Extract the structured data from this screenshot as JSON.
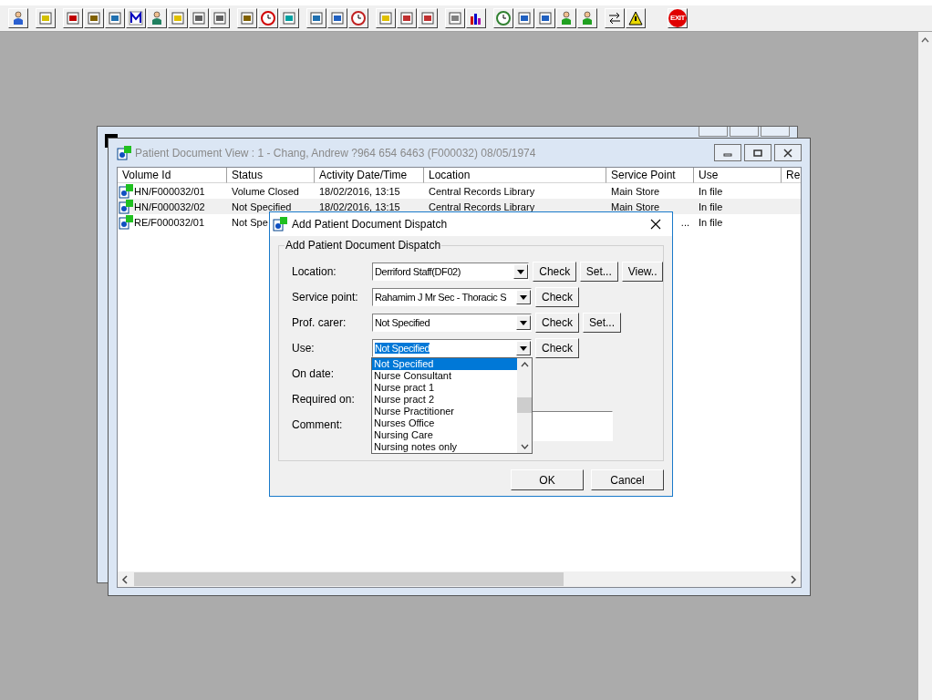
{
  "toolbar": {
    "exit_label": "EXIT"
  },
  "window": {
    "title": "Patient Document View : 1 - Chang, Andrew ?964 654 6463 (F000032) 08/05/1974",
    "active": false,
    "columns": [
      "Volume Id",
      "Status",
      "Activity Date/Time",
      "Location",
      "Service Point",
      "Use",
      "Re"
    ],
    "rows": [
      {
        "selected": false,
        "volume_id": "HN/F000032/01",
        "status": "Volume Closed",
        "activity": "18/02/2016, 13:15",
        "location": "Central Records Library",
        "service_point": "Main Store",
        "use": "In file"
      },
      {
        "selected": true,
        "volume_id": "HN/F000032/02",
        "status": "Not Specified",
        "activity": "18/02/2016, 13:15",
        "location": "Central Records Library",
        "service_point": "Main Store",
        "use": "In file"
      },
      {
        "selected": false,
        "volume_id": "RE/F000032/01",
        "status": "Not Spe",
        "service_point": "...",
        "use": "In file"
      }
    ]
  },
  "dialog": {
    "title": "Add Patient Document Dispatch",
    "group_title": "Add Patient Document Dispatch",
    "fields": [
      {
        "kind": "combo",
        "label": "Location:",
        "value": "Derriford Staff(DF02)",
        "highlighted": false,
        "buttons": [
          "Check",
          "Set...",
          "View.."
        ]
      },
      {
        "kind": "combo",
        "label": "Service point:",
        "value": "Rahamim J Mr Sec - Thoracic S",
        "highlighted": false,
        "buttons": [
          "Check"
        ]
      },
      {
        "kind": "combo",
        "label": "Prof. carer:",
        "value": "Not Specified",
        "highlighted": false,
        "buttons": [
          "Check",
          "Set..."
        ]
      },
      {
        "kind": "combo",
        "label": "Use:",
        "value": "Not Specified",
        "highlighted": true,
        "buttons": [
          "Check"
        ],
        "dropdown": {
          "expanded": true,
          "items": [
            {
              "label": "Not Specified",
              "selected": true
            },
            {
              "label": "Nurse Consultant",
              "selected": false
            },
            {
              "label": "Nurse pract 1",
              "selected": false
            },
            {
              "label": "Nurse pract 2",
              "selected": false
            },
            {
              "label": "Nurse Practitioner",
              "selected": false
            },
            {
              "label": "Nurses Office",
              "selected": false
            },
            {
              "label": "Nursing Care",
              "selected": false
            },
            {
              "label": "Nursing notes only",
              "selected": false
            }
          ]
        }
      },
      {
        "kind": "label",
        "label": "On date:"
      },
      {
        "kind": "label",
        "label": "Required on:"
      },
      {
        "kind": "text",
        "label": "Comment:"
      }
    ],
    "buttons": [
      "OK",
      "Cancel"
    ]
  }
}
